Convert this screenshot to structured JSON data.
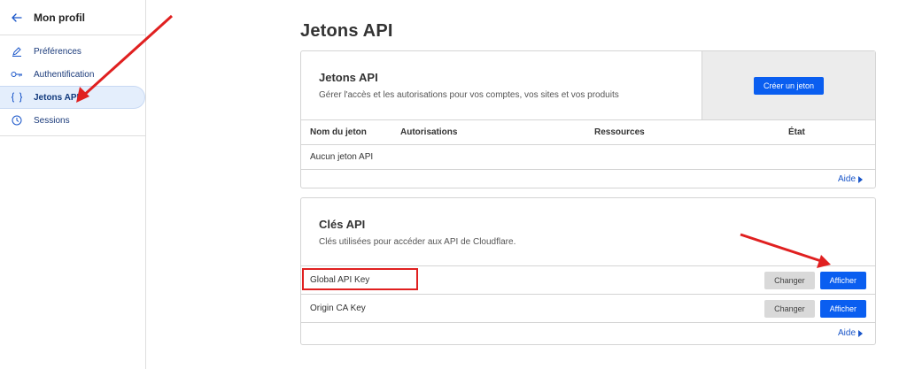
{
  "sidebar": {
    "title": "Mon profil",
    "items": [
      {
        "label": "Préférences",
        "icon": "pencil-icon"
      },
      {
        "label": "Authentification",
        "icon": "key-icon"
      },
      {
        "label": "Jetons API",
        "icon": "braces-icon"
      },
      {
        "label": "Sessions",
        "icon": "clock-icon"
      }
    ]
  },
  "main": {
    "title": "Jetons API",
    "tokens_card": {
      "title": "Jetons API",
      "description": "Gérer l'accès et les autorisations pour vos comptes, vos sites et vos produits",
      "create_button": "Créer un jeton",
      "columns": [
        "Nom du jeton",
        "Autorisations",
        "Ressources",
        "État"
      ],
      "empty_text": "Aucun jeton API",
      "help": "Aide"
    },
    "keys_card": {
      "title": "Clés API",
      "description": "Clés utilisées pour accéder aux API de Cloudflare.",
      "rows": [
        {
          "name": "Global API Key",
          "change": "Changer",
          "show": "Afficher"
        },
        {
          "name": "Origin CA Key",
          "change": "Changer",
          "show": "Afficher"
        }
      ],
      "help": "Aide"
    }
  },
  "colors": {
    "primary": "#0a5ef0",
    "annotation": "#e02020",
    "active_bg": "#e4eefc"
  }
}
